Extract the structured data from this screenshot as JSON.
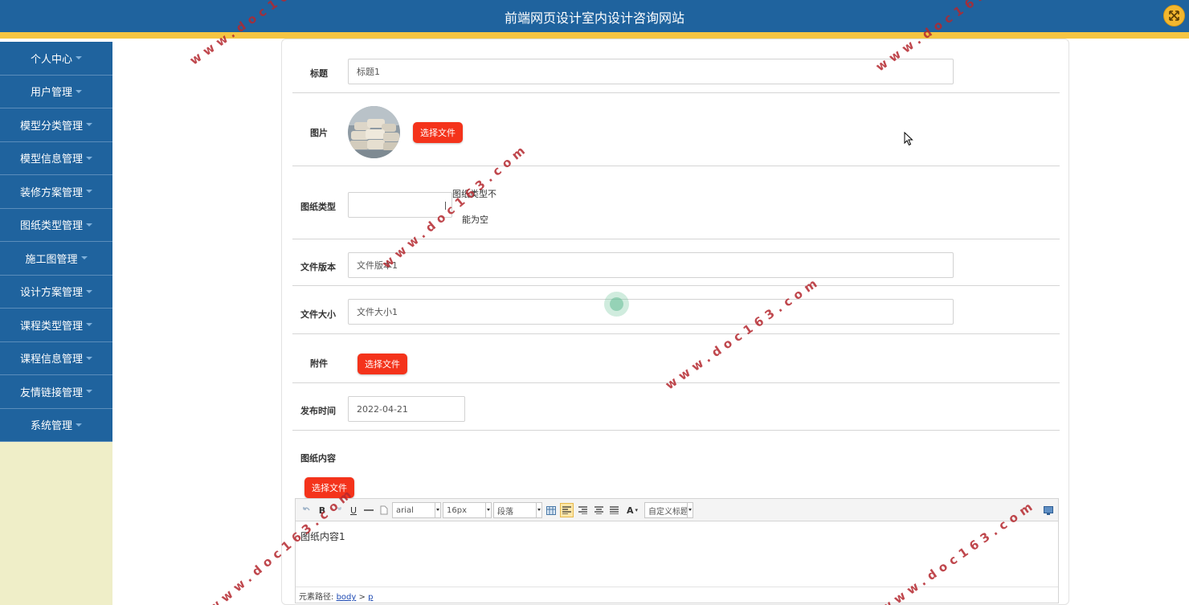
{
  "header": {
    "title": "前端网页设计室内设计咨询网站"
  },
  "sidebar": {
    "items": [
      {
        "label": "个人中心"
      },
      {
        "label": "用户管理"
      },
      {
        "label": "模型分类管理"
      },
      {
        "label": "模型信息管理"
      },
      {
        "label": "装修方案管理"
      },
      {
        "label": "图纸类型管理"
      },
      {
        "label": "施工图管理"
      },
      {
        "label": "设计方案管理"
      },
      {
        "label": "课程类型管理"
      },
      {
        "label": "课程信息管理"
      },
      {
        "label": "友情链接管理"
      },
      {
        "label": "系统管理"
      }
    ]
  },
  "form": {
    "title": {
      "label": "标题",
      "value": "标题1"
    },
    "image": {
      "label": "图片",
      "button": "选择文件"
    },
    "drawing_type": {
      "label": "图纸类型",
      "value": "",
      "error_line1": "图纸类型不",
      "error_line2": "能为空"
    },
    "file_version": {
      "label": "文件版本",
      "value": "文件版本1"
    },
    "file_size": {
      "label": "文件大小",
      "value": "文件大小1"
    },
    "attachment": {
      "label": "附件",
      "button": "选择文件"
    },
    "publish_time": {
      "label": "发布时间",
      "value": "2022-04-21"
    },
    "content": {
      "label": "图纸内容",
      "button": "选择文件"
    }
  },
  "editor": {
    "font_family": "arial",
    "font_size": "16px",
    "paragraph": "段落",
    "custom_heading": "自定义标题",
    "bold": "B",
    "italic": "I",
    "underline": "U",
    "font_color": "A",
    "content": "图纸内容1",
    "path_label": "元素路径:",
    "path_body": "body",
    "path_sep": ">",
    "path_p": "p"
  },
  "watermark": {
    "text": "www.doc163.com"
  },
  "colors": {
    "header": "#1f639e",
    "stripe": "#f5c542",
    "button": "#f4331b",
    "sidebar_bg": "#efeec8"
  }
}
